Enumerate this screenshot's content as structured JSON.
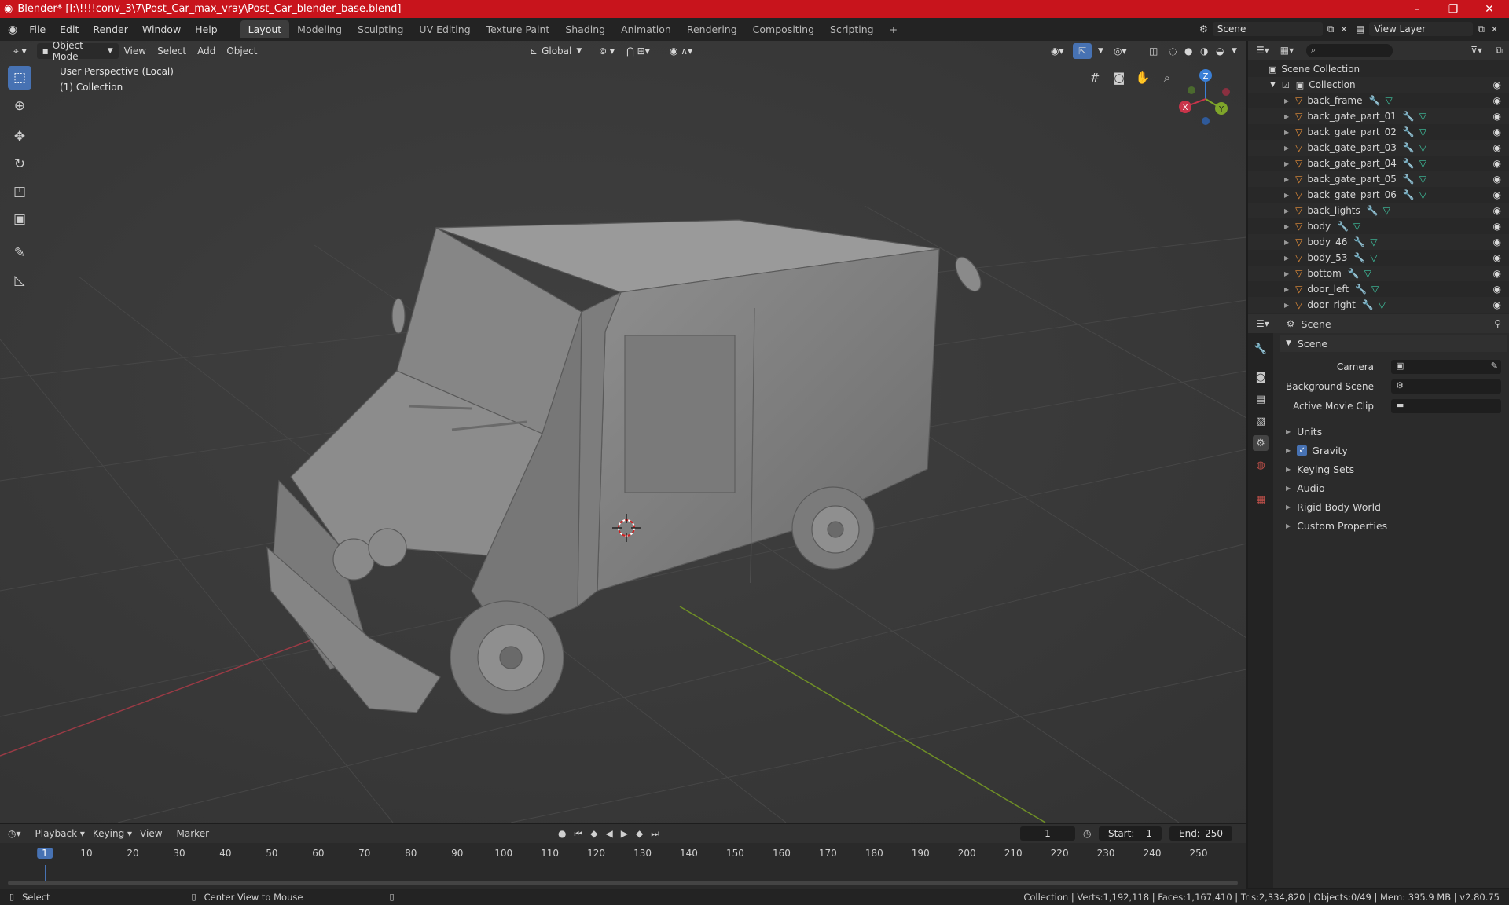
{
  "window": {
    "title": "Blender* [I:\\!!!!conv_3\\7\\Post_Car_max_vray\\Post_Car_blender_base.blend]",
    "minimize": "–",
    "maximize": "❐",
    "close": "✕"
  },
  "menu": [
    "File",
    "Edit",
    "Render",
    "Window",
    "Help"
  ],
  "workspaces": [
    "Layout",
    "Modeling",
    "Sculpting",
    "UV Editing",
    "Texture Paint",
    "Shading",
    "Animation",
    "Rendering",
    "Compositing",
    "Scripting"
  ],
  "active_workspace": "Layout",
  "add_workspace": "+",
  "scene_field": "Scene",
  "view_layer_field": "View Layer",
  "viewport_header": {
    "mode": "Object Mode",
    "view": "View",
    "select": "Select",
    "add": "Add",
    "object": "Object",
    "orientation": "Global"
  },
  "viewport": {
    "perspective": "User Perspective (Local)",
    "collection": "(1) Collection",
    "gizmo": {
      "x": "X",
      "y": "Y",
      "z": "Z"
    }
  },
  "outliner": {
    "root": "Scene Collection",
    "collection": "Collection",
    "items": [
      "back_frame",
      "back_gate_part_01",
      "back_gate_part_02",
      "back_gate_part_03",
      "back_gate_part_04",
      "back_gate_part_05",
      "back_gate_part_06",
      "back_lights",
      "body",
      "body_46",
      "body_53",
      "bottom",
      "door_left",
      "door_right"
    ]
  },
  "properties": {
    "context": "Scene",
    "panel": "Scene",
    "camera_label": "Camera",
    "background_scene_label": "Background Scene",
    "active_movie_clip_label": "Active Movie Clip",
    "sections": [
      "Units",
      "Gravity",
      "Keying Sets",
      "Audio",
      "Rigid Body World",
      "Custom Properties"
    ],
    "gravity_checked": true
  },
  "timeline": {
    "playback": "Playback",
    "keying": "Keying",
    "view": "View",
    "marker": "Marker",
    "current_frame": "1",
    "start_label": "Start:",
    "start": "1",
    "end_label": "End:",
    "end": "250",
    "ruler": [
      "1",
      "10",
      "20",
      "30",
      "40",
      "50",
      "60",
      "70",
      "80",
      "90",
      "100",
      "110",
      "120",
      "130",
      "140",
      "150",
      "160",
      "170",
      "180",
      "190",
      "200",
      "210",
      "220",
      "230",
      "240",
      "250"
    ]
  },
  "status": {
    "left": "Select",
    "middle": "Center View to Mouse",
    "right": "Collection | Verts:1,192,118 | Faces:1,167,410 | Tris:2,334,820 | Objects:0/49 | Mem: 395.9 MB | v2.80.75"
  },
  "colors": {
    "title_bar": "#c8141c",
    "accent": "#4772b3",
    "x_axis": "#c9344a",
    "y_axis": "#7fa52a",
    "z_axis": "#3a7fd6",
    "mesh_icon": "#e8903a",
    "data_icon": "#3fc7a3"
  }
}
